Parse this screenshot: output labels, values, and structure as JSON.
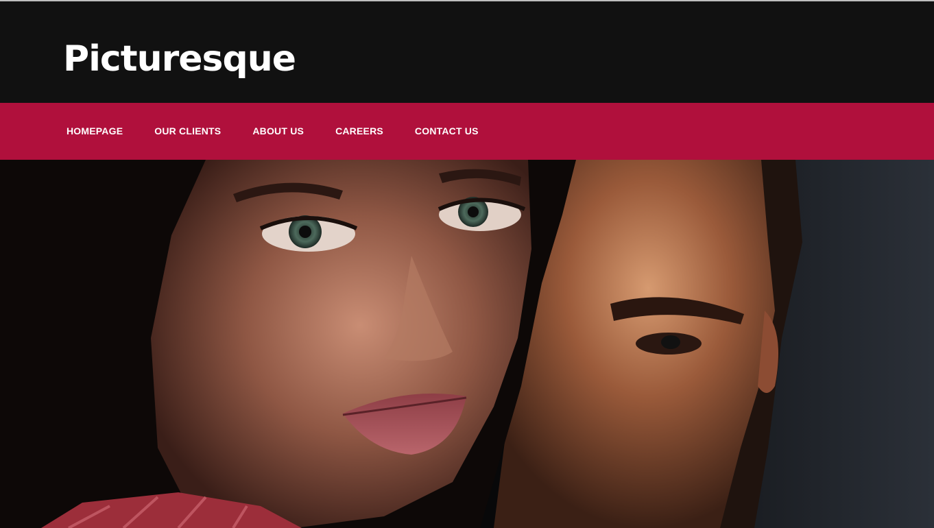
{
  "header": {
    "site_title": "Picturesque"
  },
  "nav": {
    "items": [
      {
        "label": "HOMEPAGE"
      },
      {
        "label": "OUR CLIENTS"
      },
      {
        "label": "ABOUT US"
      },
      {
        "label": "CAREERS"
      },
      {
        "label": "CONTACT US"
      }
    ]
  },
  "colors": {
    "header_bg": "#111111",
    "nav_bg": "#b0103c",
    "title_text": "#ffffff",
    "nav_text": "#ffffff"
  },
  "hero": {
    "image": "hero-photo-couple"
  }
}
